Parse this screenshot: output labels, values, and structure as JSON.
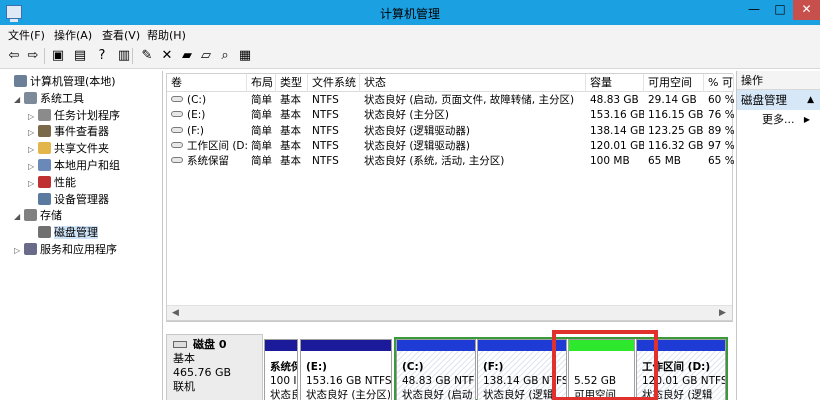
{
  "window": {
    "title": "计算机管理",
    "minimize": "—",
    "maximize": "□",
    "close": "✕"
  },
  "menu": [
    "文件(F)",
    "操作(A)",
    "查看(V)",
    "帮助(H)"
  ],
  "toolbar": [
    {
      "name": "back-arrow-icon",
      "glyph": "⇦"
    },
    {
      "name": "forward-arrow-icon",
      "glyph": "⇨"
    },
    {
      "name": "up-folder-icon",
      "glyph": "▣"
    },
    {
      "name": "show-hide-tree-icon",
      "glyph": "▤"
    },
    {
      "name": "help-icon",
      "glyph": "?"
    },
    {
      "name": "show-hide-action-pane-icon",
      "glyph": "▥"
    },
    {
      "name": "properties-icon",
      "glyph": "✎"
    },
    {
      "name": "delete-icon",
      "glyph": "✕"
    },
    {
      "name": "open-folder-icon",
      "glyph": "▰"
    },
    {
      "name": "new-folder-icon",
      "glyph": "▱"
    },
    {
      "name": "search-icon",
      "glyph": "⌕"
    },
    {
      "name": "export-icon",
      "glyph": "▦"
    }
  ],
  "tree": [
    {
      "label": "计算机管理(本地)",
      "twisty": "",
      "icon_color": "#6b7f99",
      "level": 0
    },
    {
      "label": "系统工具",
      "twisty": "◢",
      "icon_color": "#7d8a9a",
      "level": 1
    },
    {
      "label": "任务计划程序",
      "twisty": "▷",
      "icon_color": "#8b8b8b",
      "level": 2
    },
    {
      "label": "事件查看器",
      "twisty": "▷",
      "icon_color": "#7a6a4a",
      "level": 2
    },
    {
      "label": "共享文件夹",
      "twisty": "▷",
      "icon_color": "#e2b64a",
      "level": 2
    },
    {
      "label": "本地用户和组",
      "twisty": "▷",
      "icon_color": "#6a88b8",
      "level": 2
    },
    {
      "label": "性能",
      "twisty": "▷",
      "icon_color": "#c03030",
      "level": 2
    },
    {
      "label": "设备管理器",
      "twisty": "",
      "icon_color": "#5a7aa0",
      "level": 2
    },
    {
      "label": "存储",
      "twisty": "◢",
      "icon_color": "#808080",
      "level": 1
    },
    {
      "label": "磁盘管理",
      "twisty": "",
      "icon_color": "#707070",
      "level": 2,
      "selected": true
    },
    {
      "label": "服务和应用程序",
      "twisty": "▷",
      "icon_color": "#6a6a8a",
      "level": 1
    }
  ],
  "volumes": {
    "columns": [
      "卷",
      "布局",
      "类型",
      "文件系统",
      "状态",
      "容量",
      "可用空间",
      "% 可"
    ],
    "rows": [
      [
        "(C:)",
        "简单",
        "基本",
        "NTFS",
        "状态良好 (启动, 页面文件, 故障转储, 主分区)",
        "48.83 GB",
        "29.14 GB",
        "60 %"
      ],
      [
        "(E:)",
        "简单",
        "基本",
        "NTFS",
        "状态良好 (主分区)",
        "153.16 GB",
        "116.15 GB",
        "76 %"
      ],
      [
        "(F:)",
        "简单",
        "基本",
        "NTFS",
        "状态良好 (逻辑驱动器)",
        "138.14 GB",
        "123.25 GB",
        "89 %"
      ],
      [
        "工作区间 (D:)",
        "简单",
        "基本",
        "NTFS",
        "状态良好 (逻辑驱动器)",
        "120.01 GB",
        "116.32 GB",
        "97 %"
      ],
      [
        "系统保留",
        "简单",
        "基本",
        "NTFS",
        "状态良好 (系统, 活动, 主分区)",
        "100 MB",
        "65 MB",
        "65 %"
      ]
    ]
  },
  "scroll": {
    "left": "◀",
    "right": "▶"
  },
  "actions": {
    "header": "操作",
    "section": "磁盘管理",
    "section_arrow": "▲",
    "more": "更多...",
    "more_arrow": "▶"
  },
  "disk": {
    "title": "磁盘 0",
    "type": "基本",
    "size": "465.76 GB",
    "status": "联机"
  },
  "partitions": [
    {
      "name": "系统保",
      "size": "100 I",
      "status": "状态良",
      "bar": "#1a1a9a"
    },
    {
      "name": "(E:)",
      "size": "153.16 GB NTFS",
      "status": "状态良好 (主分区)",
      "bar": "#1a1a9a"
    },
    {
      "name": "(C:)",
      "size": "48.83 GB NTFS",
      "status": "状态良好 (启动",
      "bar": "#1f3bd6"
    },
    {
      "name": "(F:)",
      "size": "138.14 GB NTFS",
      "status": "状态良好 (逻辑",
      "bar": "#1f3bd6"
    },
    {
      "name": "",
      "size": "5.52 GB",
      "status": "可用空间",
      "bar": "#2ee82e"
    },
    {
      "name": "工作区间 (D:)",
      "size": "120.01 GB NTFS",
      "status": "状态良好 (逻辑",
      "bar": "#1f3bd6"
    }
  ],
  "colors": {
    "titlebar": "#1ba1e2",
    "close_button": "#c7504d",
    "extended_frame": "#3a9a3a",
    "highlight": "#e0312d"
  }
}
